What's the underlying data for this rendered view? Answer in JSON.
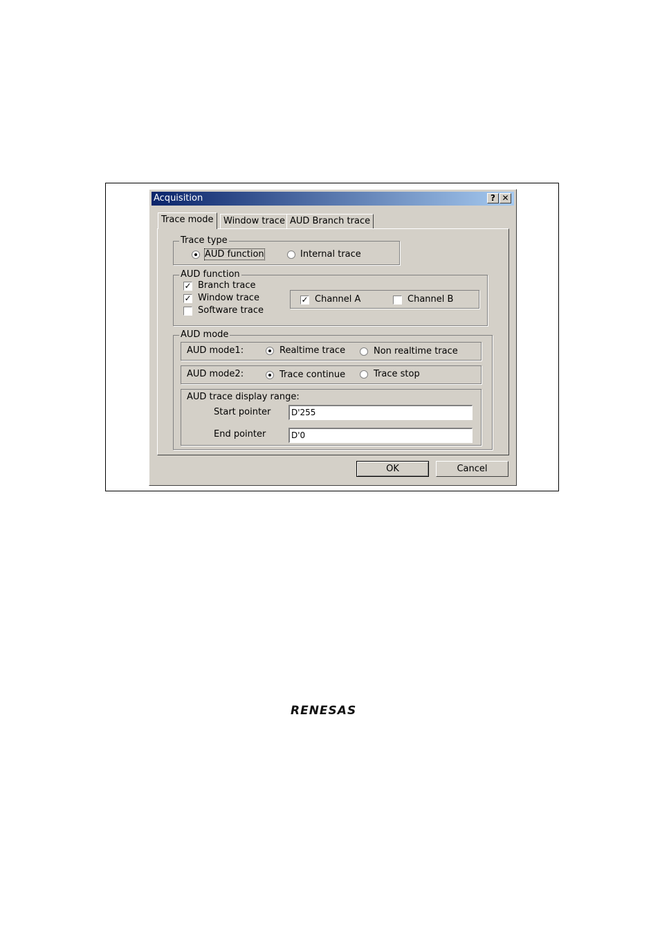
{
  "window": {
    "title": "Acquisition",
    "help_icon": "question-icon",
    "close_icon": "close-icon"
  },
  "tabs": [
    {
      "label": "Trace mode",
      "active": true
    },
    {
      "label": "Window trace",
      "active": false
    },
    {
      "label": "AUD Branch trace",
      "active": false
    }
  ],
  "trace_type": {
    "legend": "Trace type",
    "options": [
      {
        "label": "AUD function",
        "selected": true
      },
      {
        "label": "Internal trace",
        "selected": false
      }
    ]
  },
  "aud_function": {
    "legend": "AUD function",
    "checks": [
      {
        "label": "Branch trace",
        "checked": true
      },
      {
        "label": "Window trace",
        "checked": true
      },
      {
        "label": "Software trace",
        "checked": false
      }
    ],
    "channels": [
      {
        "label": "Channel A",
        "checked": true
      },
      {
        "label": "Channel B",
        "checked": false
      }
    ]
  },
  "aud_mode": {
    "legend": "AUD mode",
    "mode1": {
      "label": "AUD mode1:",
      "options": [
        {
          "label": "Realtime trace",
          "selected": true
        },
        {
          "label": "Non realtime trace",
          "selected": false
        }
      ]
    },
    "mode2": {
      "label": "AUD mode2:",
      "options": [
        {
          "label": "Trace continue",
          "selected": true
        },
        {
          "label": "Trace stop",
          "selected": false
        }
      ]
    },
    "range": {
      "legend": "AUD trace display range:",
      "start_label": "Start pointer",
      "start_value": "D'255",
      "end_label": "End pointer",
      "end_value": "D'0"
    }
  },
  "buttons": {
    "ok": "OK",
    "cancel": "Cancel"
  },
  "footer": {
    "logo": "RENESAS"
  }
}
